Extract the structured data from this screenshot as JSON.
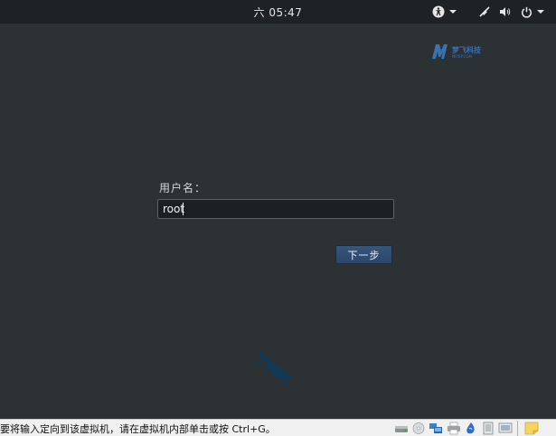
{
  "top_bar": {
    "clock": "六 05:47",
    "icons": [
      "accessibility-icon",
      "chevron-down-icon",
      "network-icon",
      "volume-icon",
      "power-icon",
      "chevron-down-icon"
    ]
  },
  "watermark": {
    "logo_text": "梦飞科技",
    "logo_subtext": "MFISP.COM"
  },
  "login": {
    "username_label": "用户名：",
    "username_value": "root",
    "next_button": "下一步"
  },
  "status_bar": {
    "message": "要将输入定向到该虚拟机，请在虚拟机内部单击或按 Ctrl+G。",
    "tray_icons": [
      "hard-disk-icon",
      "cd-drive-icon",
      "network-adapter-icon",
      "usb-icon",
      "printer-icon",
      "sound-icon",
      "display-icon",
      "message-icon",
      "notes-icon"
    ]
  },
  "colors": {
    "background": "#2c3134",
    "panel": "#1f2224",
    "accent": "#2a4668"
  }
}
